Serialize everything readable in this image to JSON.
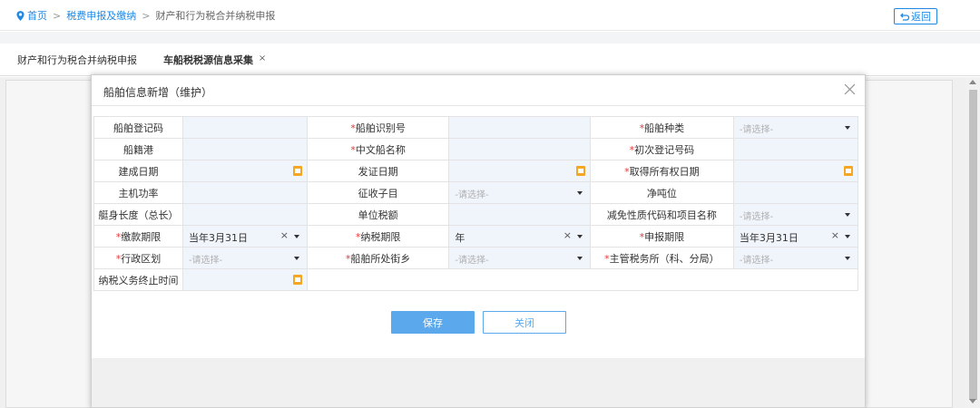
{
  "breadcrumb": {
    "home": "首页",
    "level2": "税费申报及缴纳",
    "level3": "财产和行为税合并纳税申报",
    "separator": ">"
  },
  "back_button": "返回",
  "tabs": [
    {
      "label": "财产和行为税合并纳税申报"
    },
    {
      "label": "车船税税源信息采集",
      "close": "×"
    }
  ],
  "modal": {
    "title": "船舶信息新增（维护）",
    "close": "×",
    "rows": [
      [
        {
          "label": "船舶登记码",
          "required": false,
          "type": "text",
          "value": ""
        },
        {
          "label": "船舶识别号",
          "required": true,
          "type": "text",
          "value": ""
        },
        {
          "label": "船舶种类",
          "required": true,
          "type": "select",
          "placeholder": "-请选择-"
        }
      ],
      [
        {
          "label": "船籍港",
          "required": false,
          "type": "text",
          "value": ""
        },
        {
          "label": "中文船名称",
          "required": true,
          "type": "text",
          "value": ""
        },
        {
          "label": "初次登记号码",
          "required": true,
          "type": "text",
          "value": ""
        }
      ],
      [
        {
          "label": "建成日期",
          "required": false,
          "type": "date",
          "value": ""
        },
        {
          "label": "发证日期",
          "required": false,
          "type": "date",
          "value": ""
        },
        {
          "label": "取得所有权日期",
          "required": true,
          "type": "date",
          "value": ""
        }
      ],
      [
        {
          "label": "主机功率",
          "required": false,
          "type": "text",
          "value": ""
        },
        {
          "label": "征收子目",
          "required": false,
          "type": "select",
          "placeholder": "-请选择-"
        },
        {
          "label": "净吨位",
          "required": false,
          "type": "text",
          "value": ""
        }
      ],
      [
        {
          "label": "艇身长度（总长）",
          "required": false,
          "type": "text",
          "value": ""
        },
        {
          "label": "单位税额",
          "required": false,
          "type": "text",
          "value": ""
        },
        {
          "label": "减免性质代码和项目名称",
          "required": false,
          "type": "select",
          "placeholder": "-请选择-"
        }
      ],
      [
        {
          "label": "缴款期限",
          "required": true,
          "type": "select-value",
          "value": "当年3月31日"
        },
        {
          "label": "纳税期限",
          "required": true,
          "type": "select-value",
          "value": "年"
        },
        {
          "label": "申报期限",
          "required": true,
          "type": "select-value",
          "value": "当年3月31日"
        }
      ],
      [
        {
          "label": "行政区划",
          "required": true,
          "type": "select",
          "placeholder": "-请选择-"
        },
        {
          "label": "船舶所处街乡",
          "required": true,
          "type": "select",
          "placeholder": "-请选择-"
        },
        {
          "label": "主管税务所（科、分局）",
          "required": true,
          "type": "select",
          "placeholder": "-请选择-"
        }
      ],
      [
        {
          "label": "纳税义务终止时间",
          "required": false,
          "type": "date",
          "value": ""
        }
      ]
    ],
    "save_label": "保存",
    "close_label": "关闭"
  },
  "colors": {
    "accent": "#1e88e5",
    "required": "#e53935",
    "input_bg": "#f0f4fb",
    "calendar_icon": "#f5a623",
    "primary_button": "#5ba9ec"
  }
}
